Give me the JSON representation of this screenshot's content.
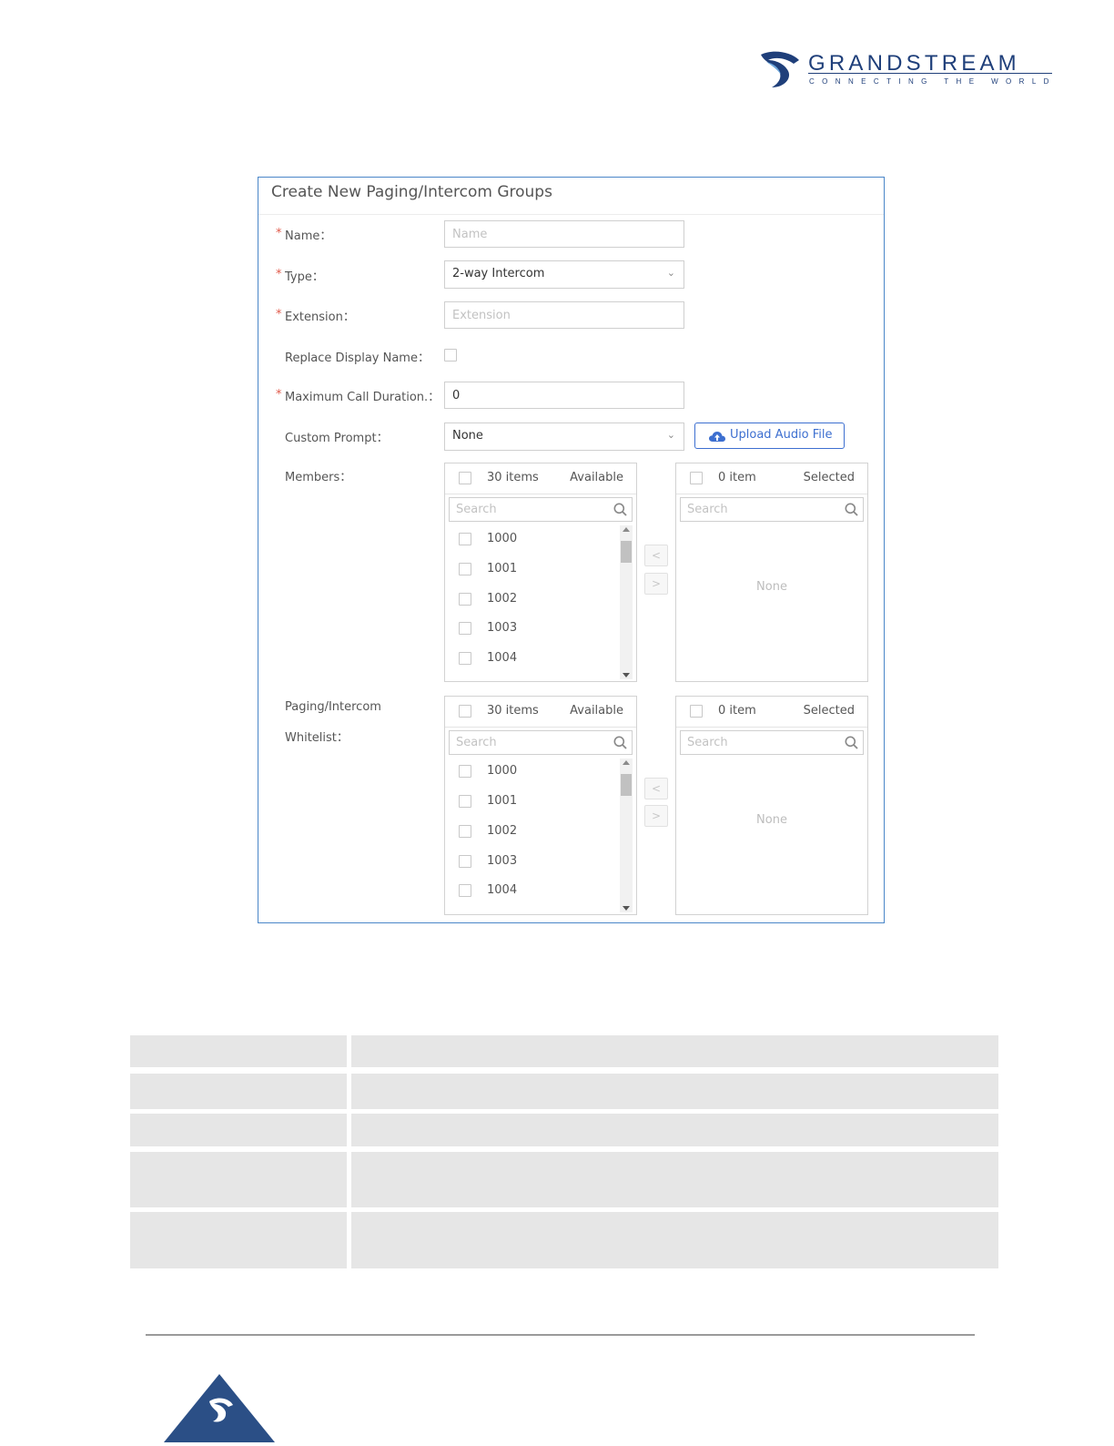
{
  "brand": {
    "name": "GRANDSTREAM",
    "tagline": "CONNECTING THE WORLD",
    "color": "#1f3f7a"
  },
  "dialog": {
    "title": "Create New Paging/Intercom Groups",
    "fields": {
      "name": {
        "label": "Name：",
        "placeholder": "Name",
        "value": ""
      },
      "type": {
        "label": "Type：",
        "value": "2-way Intercom"
      },
      "extension": {
        "label": "Extension：",
        "placeholder": "Extension",
        "value": ""
      },
      "replace_display_name": {
        "label": "Replace Display Name：",
        "checked": false
      },
      "max_call_duration": {
        "label": "Maximum Call Duration.：",
        "value": "0"
      },
      "custom_prompt": {
        "label": "Custom Prompt：",
        "value": "None",
        "upload_label": "Upload Audio File"
      }
    },
    "members": {
      "label": "Members：",
      "available": {
        "count": "30 items",
        "title": "Available",
        "search_placeholder": "Search",
        "items": [
          "1000",
          "1001",
          "1002",
          "1003",
          "1004"
        ]
      },
      "selected": {
        "count": "0 item",
        "title": "Selected",
        "search_placeholder": "Search",
        "empty": "None"
      }
    },
    "whitelist": {
      "label_line1": "Paging/Intercom",
      "label_line2": "Whitelist：",
      "available": {
        "count": "30 items",
        "title": "Available",
        "search_placeholder": "Search",
        "items": [
          "1000",
          "1001",
          "1002",
          "1003",
          "1004"
        ]
      },
      "selected": {
        "count": "0 item",
        "title": "Selected",
        "search_placeholder": "Search",
        "empty": "None"
      }
    },
    "required_mark": "*",
    "transfer_left": "<",
    "transfer_right": ">"
  },
  "colors": {
    "accent": "#3d6fd0",
    "dialog_border": "#4a86c8",
    "required": "#e05a4a",
    "table_cell": "#e6e6e6"
  }
}
